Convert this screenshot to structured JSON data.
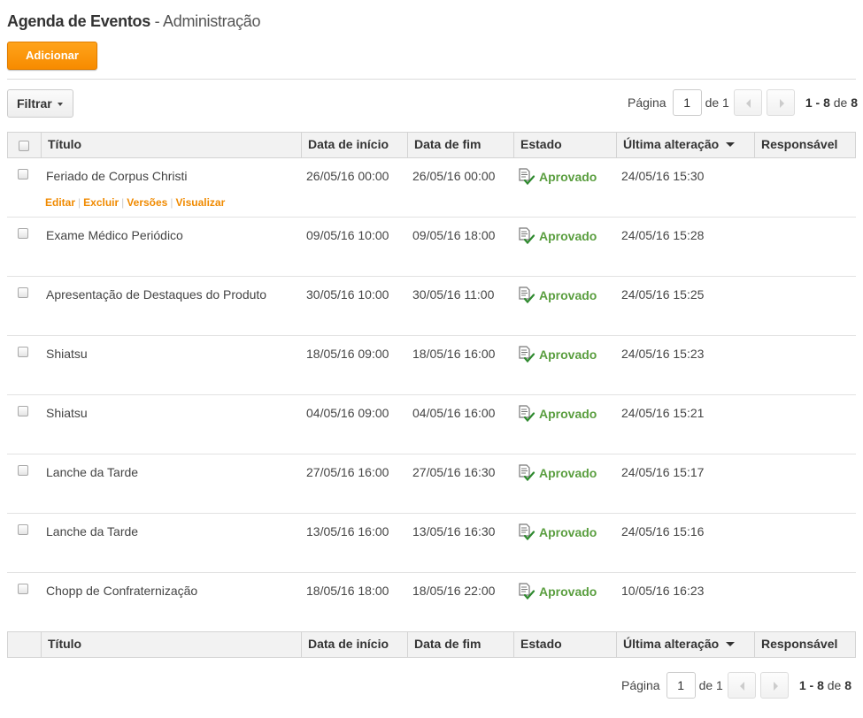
{
  "page": {
    "title_main": "Agenda de Eventos",
    "title_sub": " - Administração",
    "add_label": "Adicionar",
    "filter_label": "Filtrar"
  },
  "pager": {
    "page_label": "Página",
    "page_value": "1",
    "of_label": "de 1",
    "range": "1 - 8",
    "range_of": "de",
    "total": "8"
  },
  "columns": {
    "title": "Título",
    "start": "Data de início",
    "end": "Data de fim",
    "state": "Estado",
    "modified": "Última alteração",
    "owner": "Responsável"
  },
  "row_actions": {
    "edit": "Editar",
    "delete": "Excluir",
    "versions": "Versões",
    "view": "Visualizar"
  },
  "colors": {
    "accent": "#f78b00",
    "approved": "#5a9e3f"
  },
  "rows": [
    {
      "title": "Feriado de Corpus Christi",
      "start": "26/05/16 00:00",
      "end": "26/05/16 00:00",
      "status": "Aprovado",
      "modified": "24/05/16 15:30",
      "owner": ""
    },
    {
      "title": "Exame Médico Periódico",
      "start": "09/05/16 10:00",
      "end": "09/05/16 18:00",
      "status": "Aprovado",
      "modified": "24/05/16 15:28",
      "owner": ""
    },
    {
      "title": "Apresentação de Destaques do Produto",
      "start": "30/05/16 10:00",
      "end": "30/05/16 11:00",
      "status": "Aprovado",
      "modified": "24/05/16 15:25",
      "owner": ""
    },
    {
      "title": "Shiatsu",
      "start": "18/05/16 09:00",
      "end": "18/05/16 16:00",
      "status": "Aprovado",
      "modified": "24/05/16 15:23",
      "owner": ""
    },
    {
      "title": "Shiatsu",
      "start": "04/05/16 09:00",
      "end": "04/05/16 16:00",
      "status": "Aprovado",
      "modified": "24/05/16 15:21",
      "owner": ""
    },
    {
      "title": "Lanche da Tarde",
      "start": "27/05/16 16:00",
      "end": "27/05/16 16:30",
      "status": "Aprovado",
      "modified": "24/05/16 15:17",
      "owner": ""
    },
    {
      "title": "Lanche da Tarde",
      "start": "13/05/16 16:00",
      "end": "13/05/16 16:30",
      "status": "Aprovado",
      "modified": "24/05/16 15:16",
      "owner": ""
    },
    {
      "title": "Chopp de Confraternização",
      "start": "18/05/16 18:00",
      "end": "18/05/16 22:00",
      "status": "Aprovado",
      "modified": "10/05/16 16:23",
      "owner": ""
    }
  ]
}
